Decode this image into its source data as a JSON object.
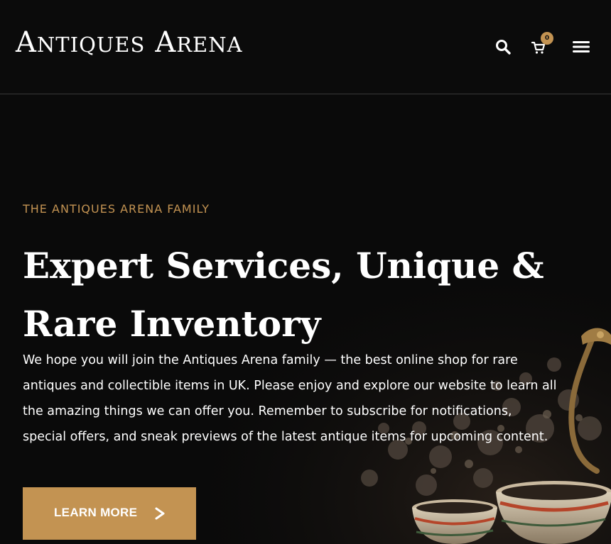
{
  "header": {
    "logo": {
      "word1_initial": "A",
      "word1_rest": "ntiques",
      "word2_initial": "A",
      "word2_rest": "rena"
    },
    "cart_count": "0",
    "icons": {
      "search": "search-icon",
      "cart": "cart-icon",
      "menu": "hamburger-menu-icon"
    }
  },
  "hero": {
    "eyebrow": "THE ANTIQUES ARENA FAMILY",
    "headline_lines": [
      "Expert Services, Unique &",
      "Rare Inventory"
    ],
    "body_lines": [
      "We hope you will join the Antiques Arena family — the best online shop for rare",
      "antiques and collectible items in UK. Please enjoy and explore our website to learn all",
      "the amazing things we can offer you. Remember to subscribe for notifications,",
      "special offers, and sneak previews of the latest antique items for upcoming content."
    ],
    "cta": {
      "label": "LEARN MORE",
      "icon": "chevron-right-icon"
    }
  },
  "colors": {
    "background": "#0a0a0a",
    "accent": "#c39352",
    "text": "#ffffff",
    "divider": "#3a3a3a"
  }
}
